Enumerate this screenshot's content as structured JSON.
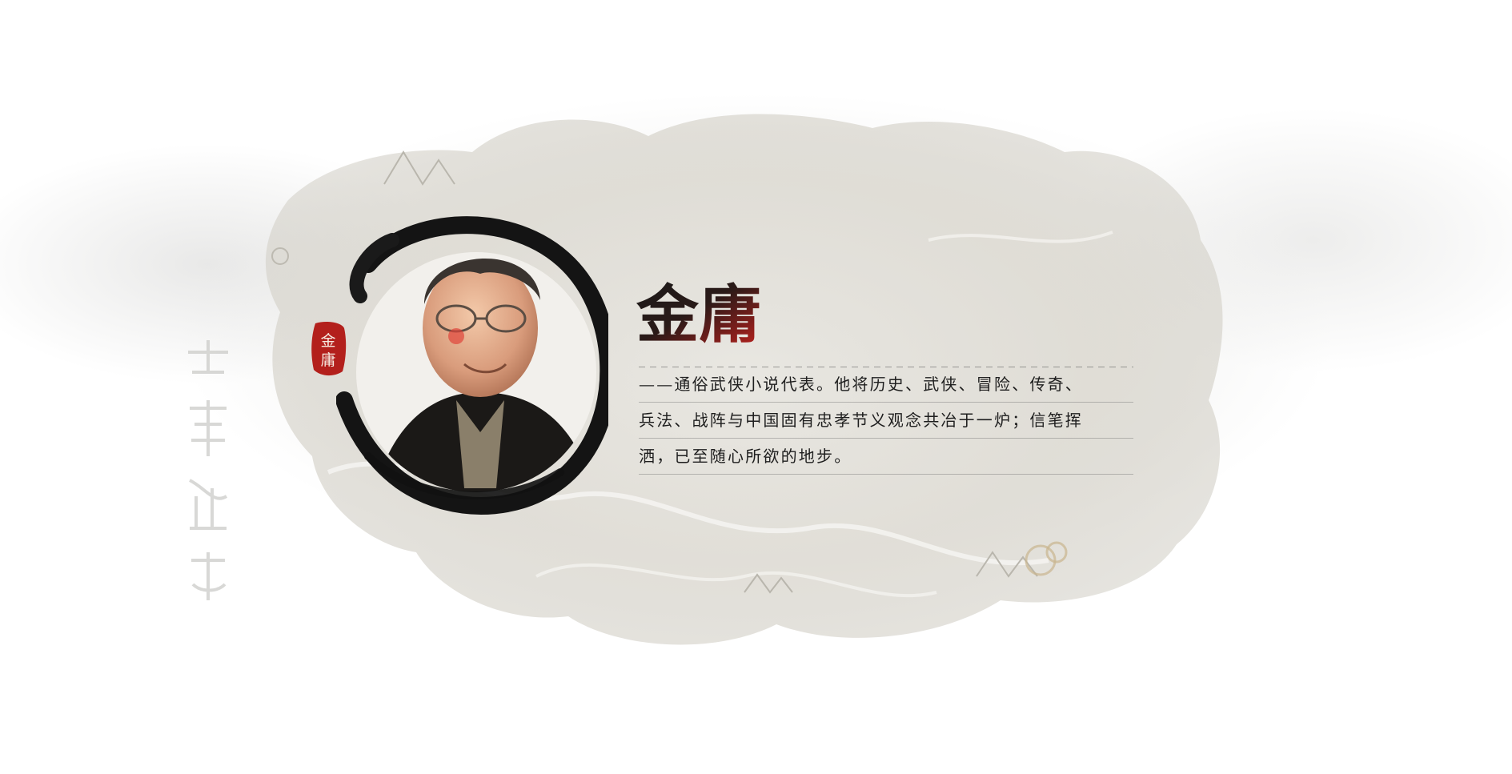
{
  "profile": {
    "name": "金庸",
    "seal_text": "金庸",
    "description_lines": [
      "——通俗武侠小说代表。他将历史、武侠、冒险、传奇、",
      "兵法、战阵与中国固有忠孝节义观念共冶于一炉；信笔挥",
      "洒，已至随心所欲的地步。"
    ]
  },
  "colors": {
    "ink": "#1e1e1e",
    "seal_red": "#b3201c",
    "title_red": "#c4221e",
    "parchment": "#d8d5cc"
  }
}
